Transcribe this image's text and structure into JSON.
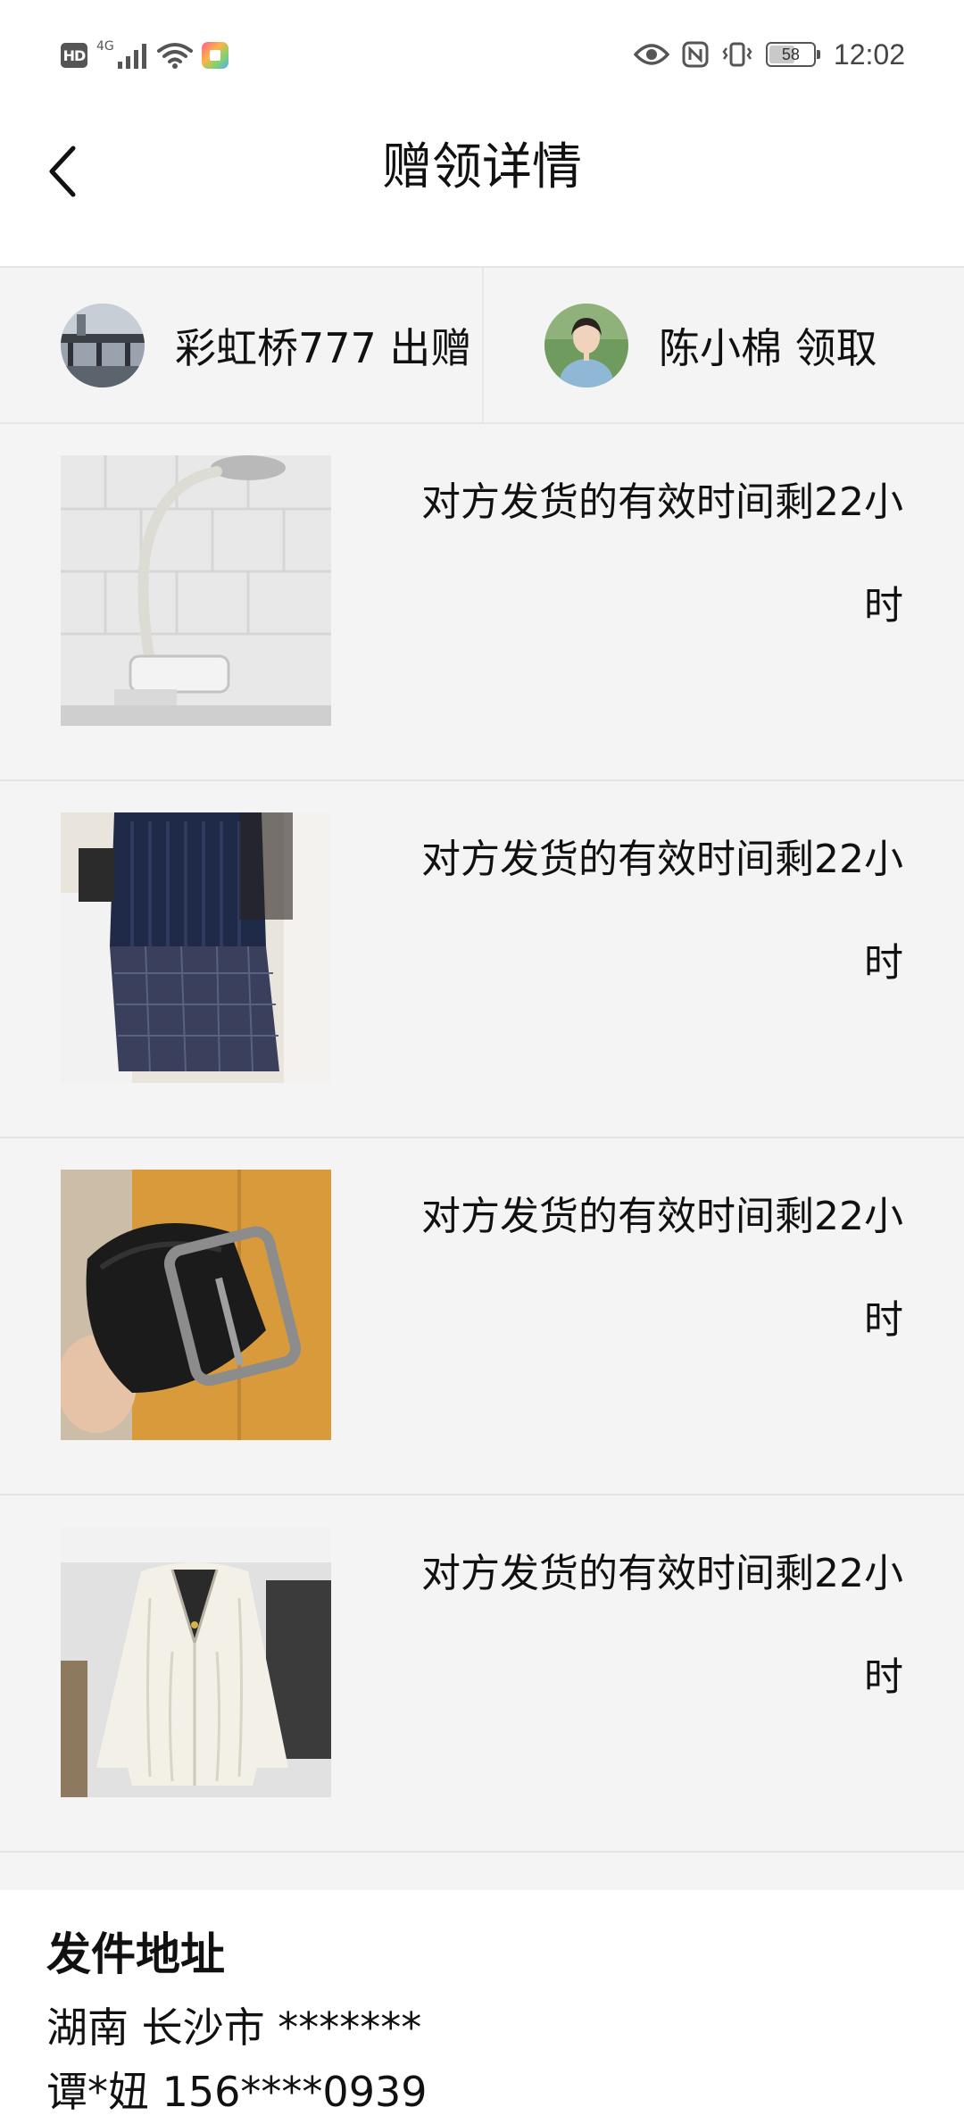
{
  "status_bar": {
    "hd_label": "HD",
    "network_label": "4G",
    "battery_level": "58",
    "time": "12:02",
    "icons": [
      "hd-icon",
      "signal-icon",
      "wifi-icon",
      "app-notification-icon",
      "eye-icon",
      "nfc-icon",
      "vibrate-icon",
      "battery-icon"
    ]
  },
  "header": {
    "title": "赠领详情",
    "back_icon": "chevron-left-icon"
  },
  "participants": {
    "giver": {
      "label": "彩虹桥777 出赠",
      "avatar": "bridge-photo"
    },
    "receiver": {
      "label": "陈小棉 领取",
      "avatar": "girl-photo"
    }
  },
  "gifts": [
    {
      "image": "desk-lamp-photo",
      "status": "对方发货的有效时间剩22小时"
    },
    {
      "image": "navy-vest-plaid-skirt-photo",
      "status": "对方发货的有效时间剩22小时"
    },
    {
      "image": "black-leather-belt-photo",
      "status": "对方发货的有效时间剩22小时"
    },
    {
      "image": "white-cable-knit-cardigan-photo",
      "status": "对方发货的有效时间剩22小时"
    }
  ],
  "address": {
    "heading": "发件地址",
    "line1": "湖南 长沙市 *******",
    "line2": "谭*妞 156****0939"
  },
  "colors": {
    "page_bg": "#ffffff",
    "list_bg": "#f4f4f4",
    "divider": "#e4e4e4",
    "text": "#111111"
  }
}
